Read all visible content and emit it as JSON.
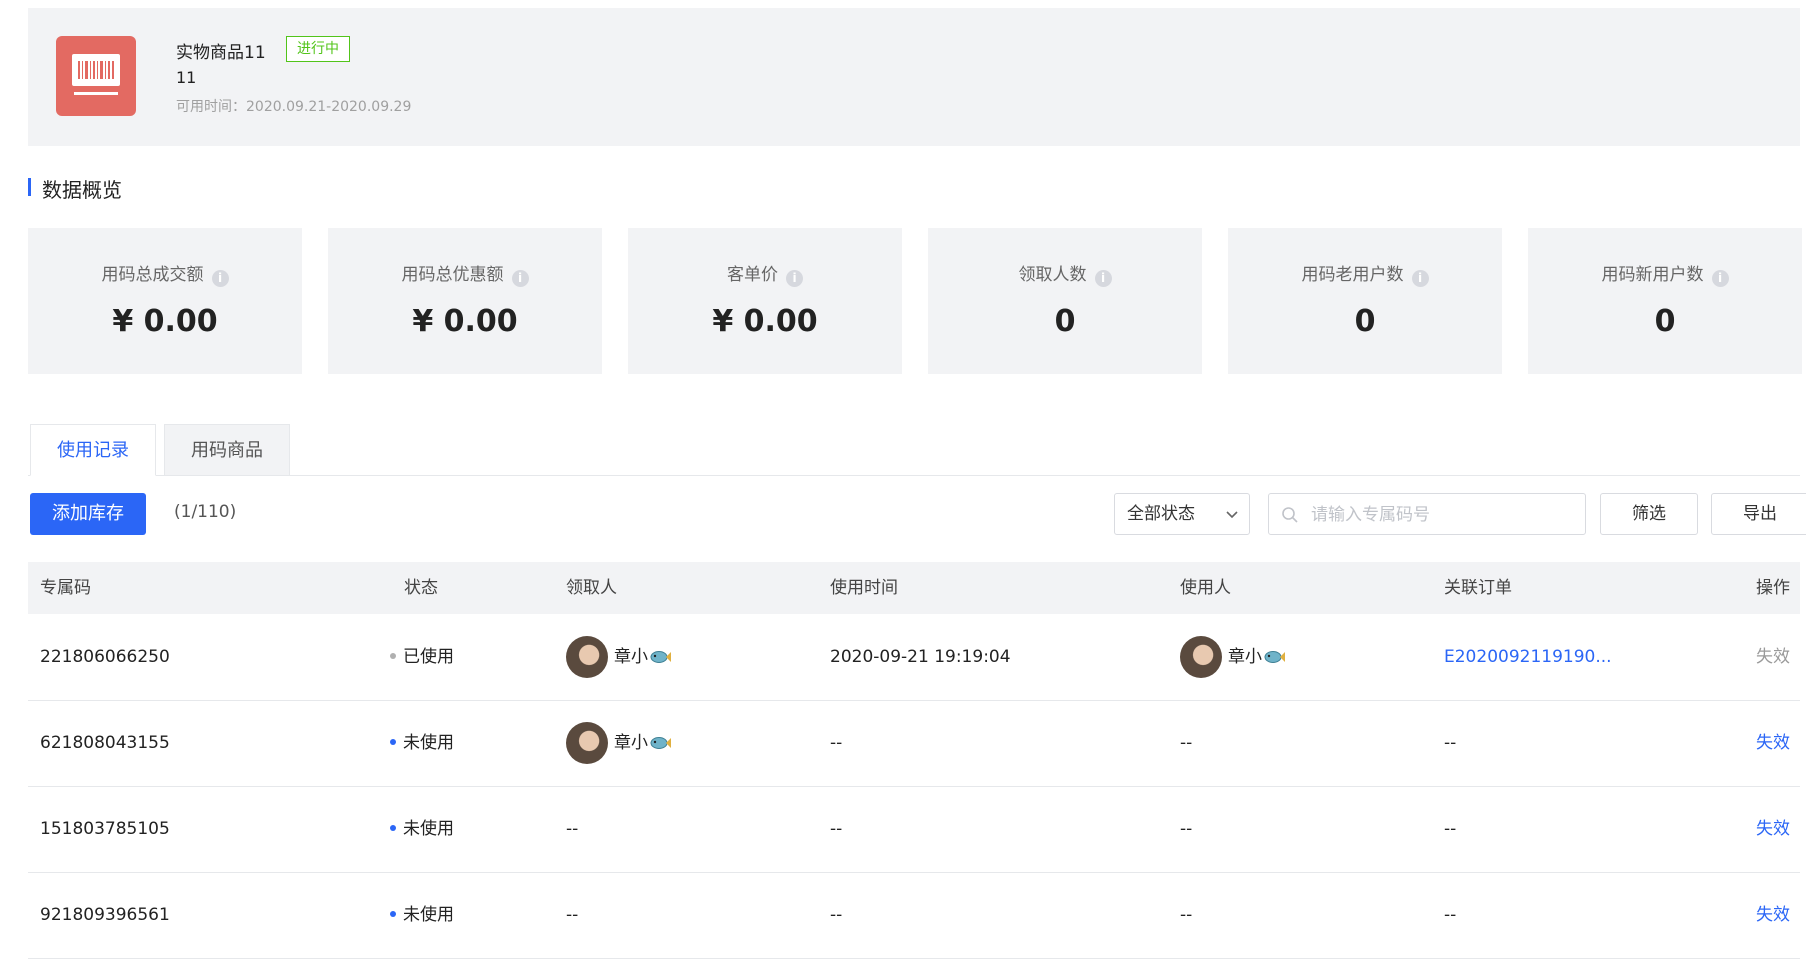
{
  "product": {
    "name": "实物商品11",
    "status": "进行中",
    "subtitle": "11",
    "time": "可用时间：2020.09.21-2020.09.29",
    "icon": "barcode-icon"
  },
  "overview": {
    "title": "数据概览",
    "stats": [
      {
        "label": "用码总成交额",
        "value": "¥ 0.00"
      },
      {
        "label": "用码总优惠额",
        "value": "¥ 0.00"
      },
      {
        "label": "客单价",
        "value": "¥ 0.00"
      },
      {
        "label": "领取人数",
        "value": "0"
      },
      {
        "label": "用码老用户数",
        "value": "0"
      },
      {
        "label": "用码新用户数",
        "value": "0"
      }
    ]
  },
  "tabs": [
    {
      "label": "使用记录",
      "active": true
    },
    {
      "label": "用码商品",
      "active": false
    }
  ],
  "toolbar": {
    "add_label": "添加库存",
    "count": "(1/110)",
    "status_select": "全部状态",
    "search_placeholder": "请输入专属码号",
    "filter_label": "筛选",
    "export_label": "导出"
  },
  "table": {
    "columns": [
      "专属码",
      "状态",
      "领取人",
      "使用时间",
      "使用人",
      "关联订单",
      "操作"
    ],
    "rows": [
      {
        "code": "221806066250",
        "status": "已使用",
        "status_color": "#b0b0b0",
        "receiver": "章小",
        "use_time": "2020-09-21 19:19:04",
        "user": "章小",
        "order": "E2020092119190...",
        "action": "失效",
        "action_enabled": false
      },
      {
        "code": "621808043155",
        "status": "未使用",
        "status_color": "#2b66f6",
        "receiver": "章小",
        "use_time": "--",
        "user": "--",
        "order": "--",
        "action": "失效",
        "action_enabled": true
      },
      {
        "code": "151803785105",
        "status": "未使用",
        "status_color": "#2b66f6",
        "receiver": "--",
        "use_time": "--",
        "user": "--",
        "order": "--",
        "action": "失效",
        "action_enabled": true
      },
      {
        "code": "921809396561",
        "status": "未使用",
        "status_color": "#2b66f6",
        "receiver": "--",
        "use_time": "--",
        "user": "--",
        "order": "--",
        "action": "失效",
        "action_enabled": true
      }
    ]
  },
  "colors": {
    "accent": "#2b66f6",
    "success": "#52c41a",
    "product_icon_bg": "#e36a62"
  }
}
